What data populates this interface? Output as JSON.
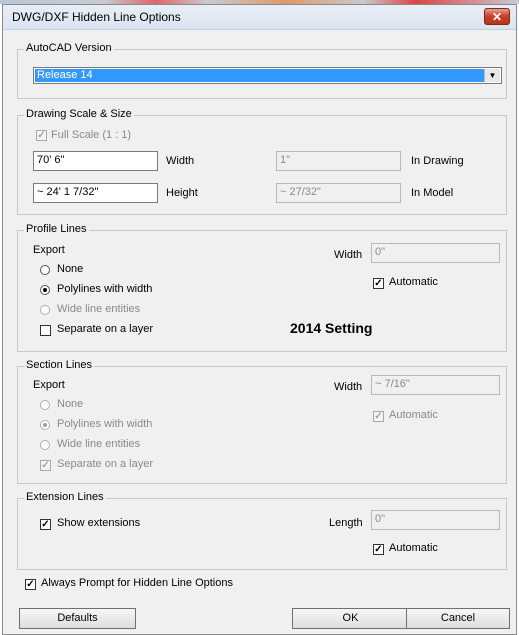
{
  "window": {
    "title": "DWG/DXF Hidden Line Options",
    "close_glyph": "✕"
  },
  "autocad": {
    "legend": "AutoCAD Version",
    "selected": "Release 14",
    "arrow": "▼"
  },
  "scale": {
    "legend": "Drawing Scale & Size",
    "full_scale_label": "Full Scale (1 : 1)",
    "width_value": "70' 6\"",
    "width_label": "Width",
    "height_value": "~ 24' 1 7/32\"",
    "height_label": "Height",
    "in_drawing_value": "1\"",
    "in_drawing_label": "In Drawing",
    "in_model_value": "~ 27/32\"",
    "in_model_label": "In Model"
  },
  "profile": {
    "legend": "Profile Lines",
    "export_label": "Export",
    "options": [
      "None",
      "Polylines with width",
      "Wide line entities"
    ],
    "separate_label": "Separate on a layer",
    "width_label": "Width",
    "width_value": "0\"",
    "automatic_label": "Automatic",
    "note": "2014 Setting"
  },
  "section": {
    "legend": "Section Lines",
    "export_label": "Export",
    "options": [
      "None",
      "Polylines with width",
      "Wide line entities"
    ],
    "separate_label": "Separate on a layer",
    "width_label": "Width",
    "width_value": "~ 7/16\"",
    "automatic_label": "Automatic"
  },
  "extension": {
    "legend": "Extension Lines",
    "show_label": "Show extensions",
    "length_label": "Length",
    "length_value": "0\"",
    "automatic_label": "Automatic"
  },
  "always_prompt_label": "Always Prompt for Hidden Line Options",
  "buttons": {
    "defaults": "Defaults",
    "ok": "OK",
    "cancel": "Cancel"
  },
  "check_glyph": "✓"
}
